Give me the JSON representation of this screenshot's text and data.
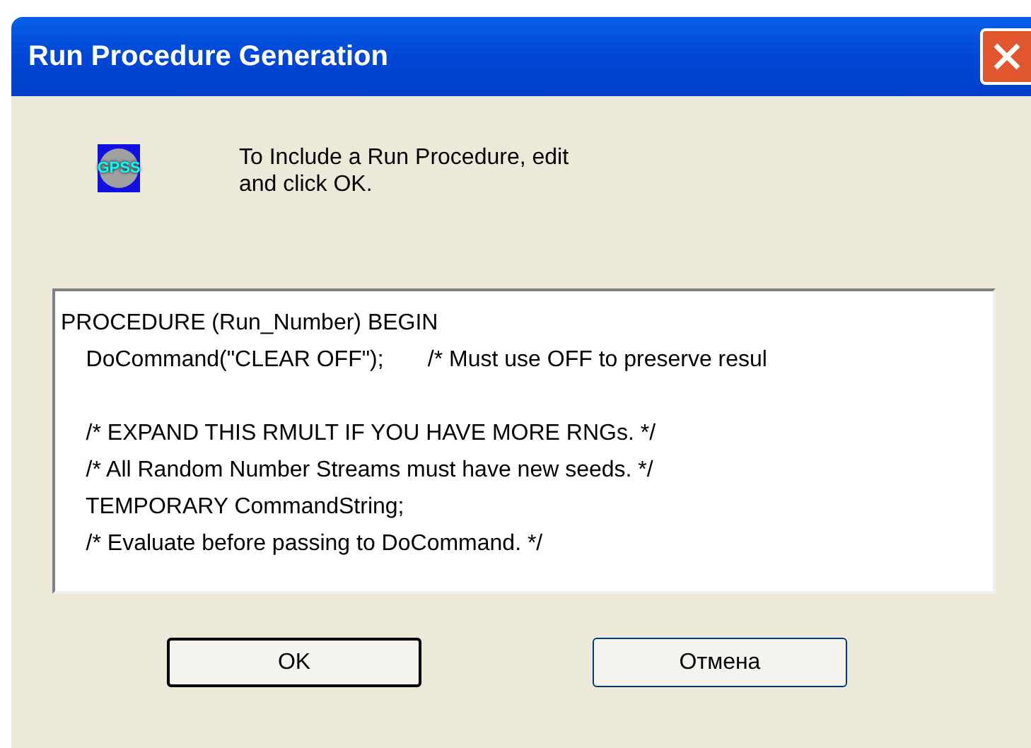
{
  "window": {
    "title": "Run Procedure Generation"
  },
  "message": "To Include a Run Procedure, edit\nand click OK.",
  "editor": {
    "value": "PROCEDURE (Run_Number) BEGIN\n    DoCommand(\"CLEAR OFF\");       /* Must use OFF to preserve resul\n\n    /* EXPAND THIS RMULT IF YOU HAVE MORE RNGs. */\n    /* All Random Number Streams must have new seeds. */\n    TEMPORARY CommandString;\n    /* Evaluate before passing to DoCommand. */"
  },
  "icon_label": "GPSS",
  "buttons": [
    {
      "label": "OK",
      "kind": "default"
    },
    {
      "label": "Отмена",
      "kind": "normal"
    }
  ]
}
